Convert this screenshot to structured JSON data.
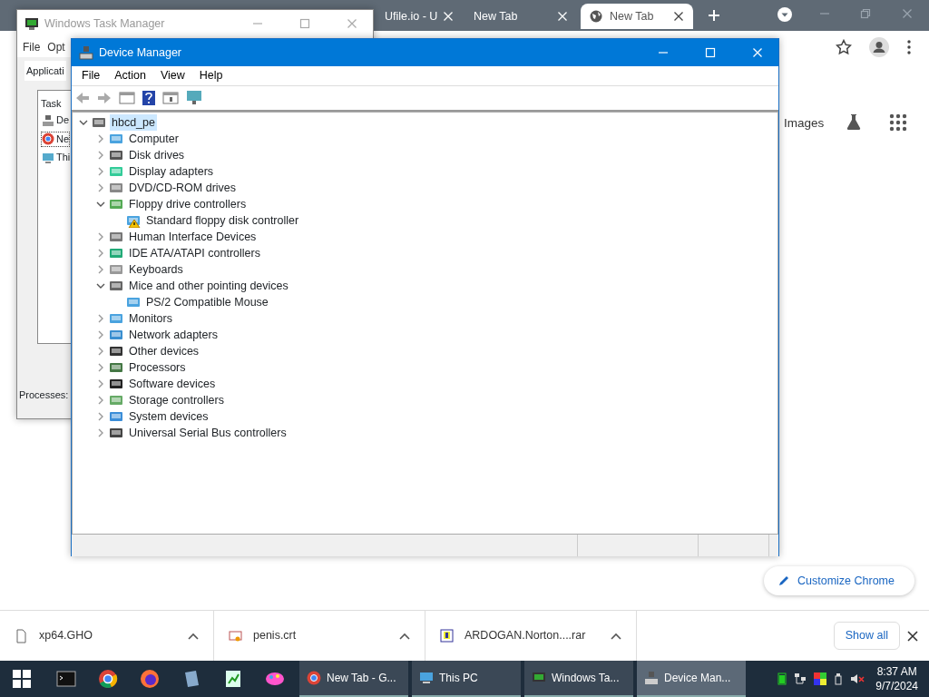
{
  "browser": {
    "tabs": [
      {
        "label": "Ufile.io - U",
        "selected": false
      },
      {
        "label": "New Tab",
        "selected": false
      },
      {
        "label": "New Tab",
        "selected": true
      }
    ],
    "images_link": "Images",
    "customize_button": "Customize Chrome",
    "downloads": [
      {
        "name": "xp64.GHO"
      },
      {
        "name": "penis.crt"
      },
      {
        "name": "ARDOGAN.Norton....rar"
      }
    ],
    "show_all": "Show all"
  },
  "task_manager": {
    "title": "Windows Task Manager",
    "menu": [
      "File",
      "Opt"
    ],
    "tab": "Applicati",
    "column": "Task",
    "tasks": [
      {
        "label": "De",
        "selected": false
      },
      {
        "label": "Ne",
        "selected": true
      },
      {
        "label": "Thi",
        "selected": false
      }
    ],
    "status": "Processes:"
  },
  "device_manager": {
    "title": "Device Manager",
    "menu": [
      "File",
      "Action",
      "View",
      "Help"
    ],
    "tree": [
      {
        "label": "hbcd_pe",
        "selected": true,
        "expanded": true,
        "children": [
          {
            "label": "Computer",
            "expanded": false
          },
          {
            "label": "Disk drives",
            "expanded": false
          },
          {
            "label": "Display adapters",
            "expanded": false
          },
          {
            "label": "DVD/CD-ROM drives",
            "expanded": false
          },
          {
            "label": "Floppy drive controllers",
            "expanded": true,
            "children": [
              {
                "label": "Standard floppy disk controller",
                "warning": true
              }
            ]
          },
          {
            "label": "Human Interface Devices",
            "expanded": false
          },
          {
            "label": "IDE ATA/ATAPI controllers",
            "expanded": false
          },
          {
            "label": "Keyboards",
            "expanded": false
          },
          {
            "label": "Mice and other pointing devices",
            "expanded": true,
            "children": [
              {
                "label": "PS/2 Compatible Mouse",
                "warning": false
              }
            ]
          },
          {
            "label": "Monitors",
            "expanded": false
          },
          {
            "label": "Network adapters",
            "expanded": false
          },
          {
            "label": "Other devices",
            "expanded": false
          },
          {
            "label": "Processors",
            "expanded": false
          },
          {
            "label": "Software devices",
            "expanded": false
          },
          {
            "label": "Storage controllers",
            "expanded": false
          },
          {
            "label": "System devices",
            "expanded": false
          },
          {
            "label": "Universal Serial Bus controllers",
            "expanded": false
          }
        ]
      }
    ]
  },
  "taskbar": {
    "windows": [
      {
        "label": "New Tab - G...",
        "selected": false
      },
      {
        "label": "This PC",
        "selected": false
      },
      {
        "label": "Windows Ta...",
        "selected": false
      },
      {
        "label": "Device Man...",
        "selected": true
      }
    ],
    "time": "8:37 AM",
    "date": "9/7/2024"
  }
}
